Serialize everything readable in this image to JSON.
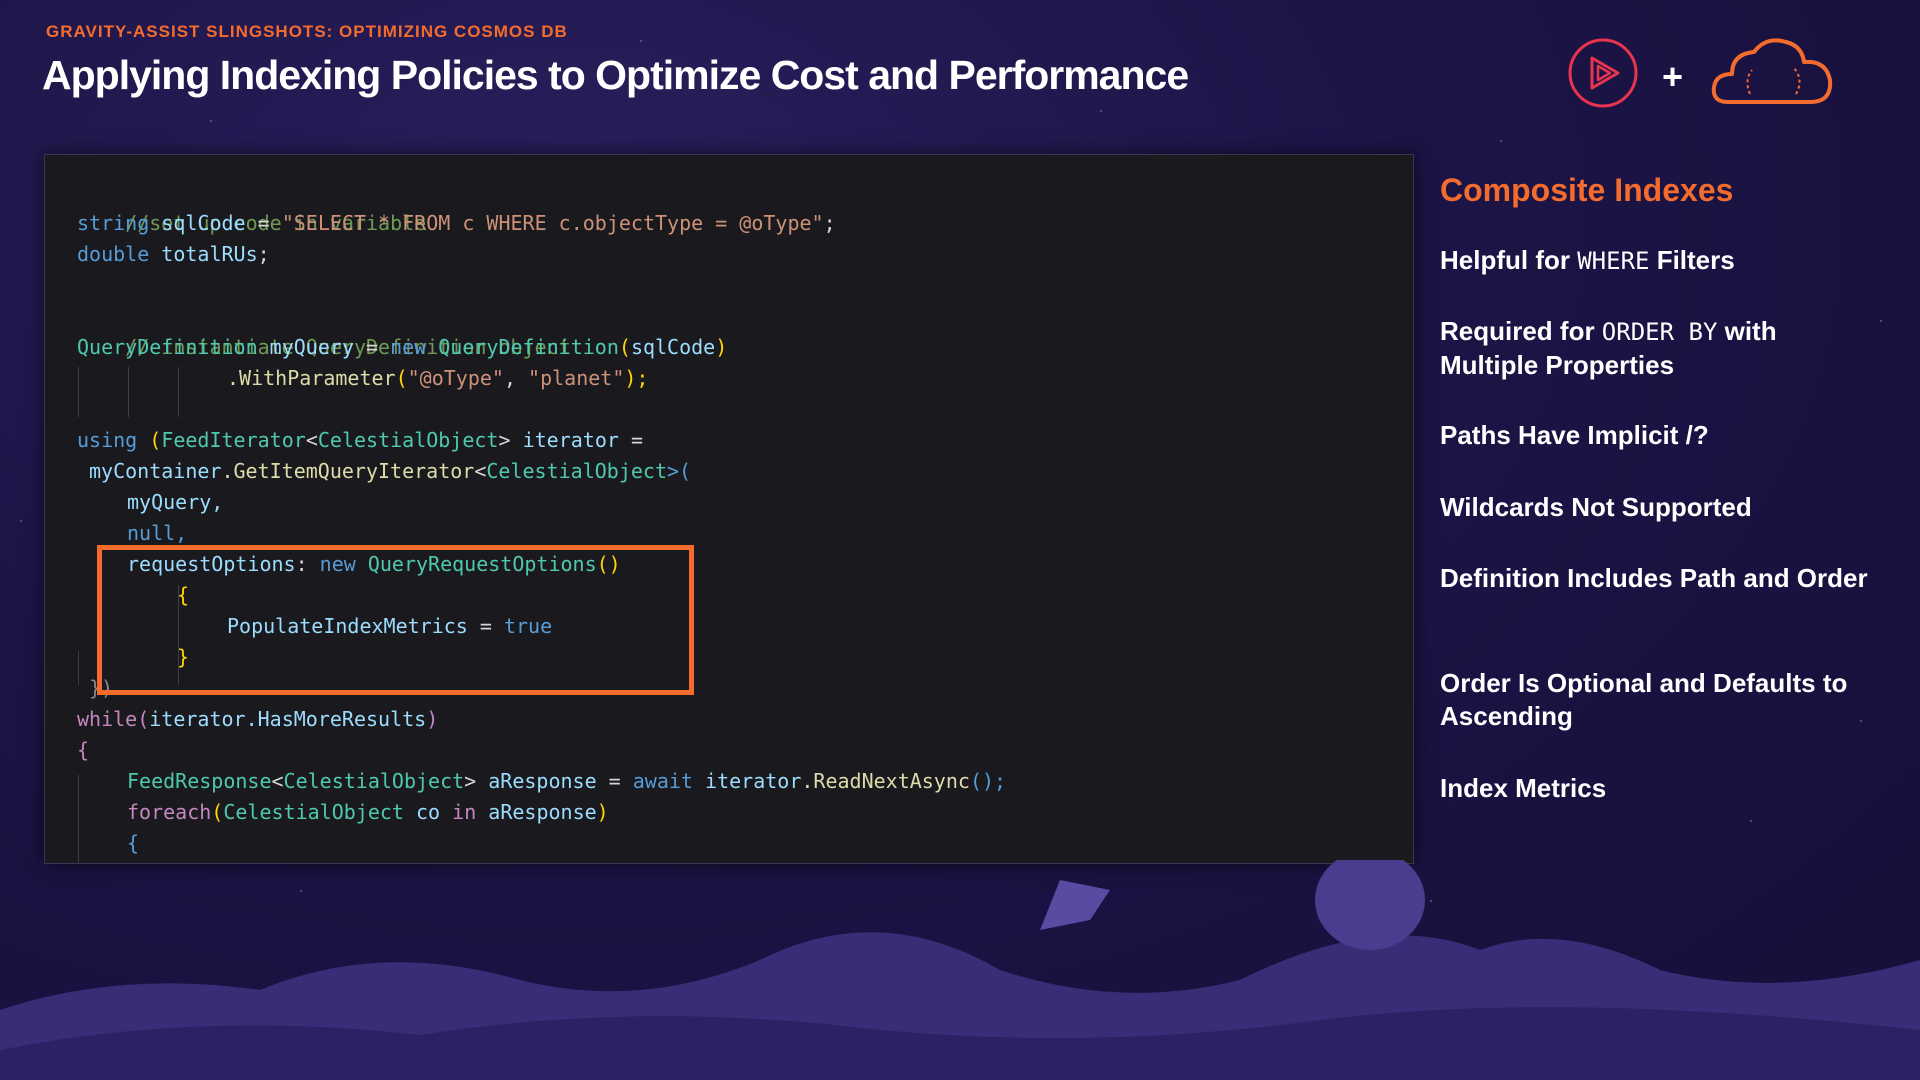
{
  "header": {
    "subtitle": "GRAVITY-ASSIST SLINGSHOTS: OPTIMIZING COSMOS DB",
    "title": "Applying Indexing Policies to Optimize Cost and Performance",
    "logos": [
      "play-logo-icon",
      "cloud-logo-icon"
    ],
    "plus": "+"
  },
  "colors": {
    "accent": "#f36c2e",
    "background": "#1c1446",
    "code_background": "#1a1a1e"
  },
  "code": {
    "l1": "//set up code in variable",
    "l2_kw": "string",
    "l2_var": "sqlCode",
    "l2_op": " = ",
    "l2_str": "\"SELECT * FROM c WHERE c.objectType = @oType\"",
    "l2_end": ";",
    "l3_kw": "double",
    "l3_var": "totalRUs",
    "l3_end": ";",
    "l5": "// instantiate QueryDefinition object",
    "l6_type": "QueryDefinition",
    "l6_var": "myQuery",
    "l6_op": " = ",
    "l6_kw": "new",
    "l6_type2": "QueryDefinition",
    "l6_p1": "(",
    "l6_var2": "sqlCode",
    "l6_p2": ")",
    "l7_fn": ".WithParameter",
    "l7_p1": "(",
    "l7_str1": "\"@oType\"",
    "l7_comma": ", ",
    "l7_str2": "\"planet\"",
    "l7_end": ");",
    "l9_kw": "using",
    "l9_p1": " (",
    "l9_type": "FeedIterator",
    "l9_lt": "<",
    "l9_type2": "CelestialObject",
    "l9_gt": ">",
    "l9_var": "iterator",
    "l9_end": " =",
    "l10_var": "myContainer",
    "l10_fn": ".GetItemQueryIterator",
    "l10_lt": "<",
    "l10_type": "CelestialObject",
    "l10_end": ">(",
    "l11": "myQuery,",
    "l12": "null,",
    "l13_var": "requestOptions",
    "l13_colon": ": ",
    "l13_kw": "new",
    "l13_type": "QueryRequestOptions",
    "l13_end": "()",
    "l14": "{",
    "l15_var": "PopulateIndexMetrics",
    "l15_op": " = ",
    "l15_kw": "true",
    "l16": "}",
    "l17": "})",
    "l18_ctl": "while",
    "l18_p1": "(",
    "l18_var": "iterator",
    "l18_fn": ".HasMoreResults",
    "l18_p2": ")",
    "l19": "{",
    "l20_type": "FeedResponse",
    "l20_lt": "<",
    "l20_type2": "CelestialObject",
    "l20_gt": ">",
    "l20_var": "aResponse",
    "l20_op": " = ",
    "l20_kw": "await",
    "l20_var2": "iterator",
    "l20_fn": ".ReadNextAsync",
    "l20_end": "();",
    "l21_ctl": "foreach",
    "l21_p1": "(",
    "l21_type": "CelestialObject",
    "l21_var": "co",
    "l21_kw": "in",
    "l21_var2": "aResponse",
    "l21_p2": ")",
    "l22": "{"
  },
  "sidebar": {
    "heading": "Composite Indexes",
    "items": [
      {
        "pre": "Helpful for ",
        "mono": "WHERE",
        "post": " Filters"
      },
      {
        "pre": "Required for ",
        "mono": "ORDER BY",
        "post": " with Multiple Properties"
      },
      {
        "pre": "Paths Have Implicit /?",
        "mono": "",
        "post": ""
      },
      {
        "pre": "Wildcards Not Supported",
        "mono": "",
        "post": ""
      },
      {
        "pre": "Definition Includes Path and Order",
        "mono": "",
        "post": ""
      },
      {
        "pre": "Order Is Optional and Defaults to Ascending",
        "mono": "",
        "post": ""
      },
      {
        "pre": "Index Metrics",
        "mono": "",
        "post": ""
      }
    ]
  }
}
